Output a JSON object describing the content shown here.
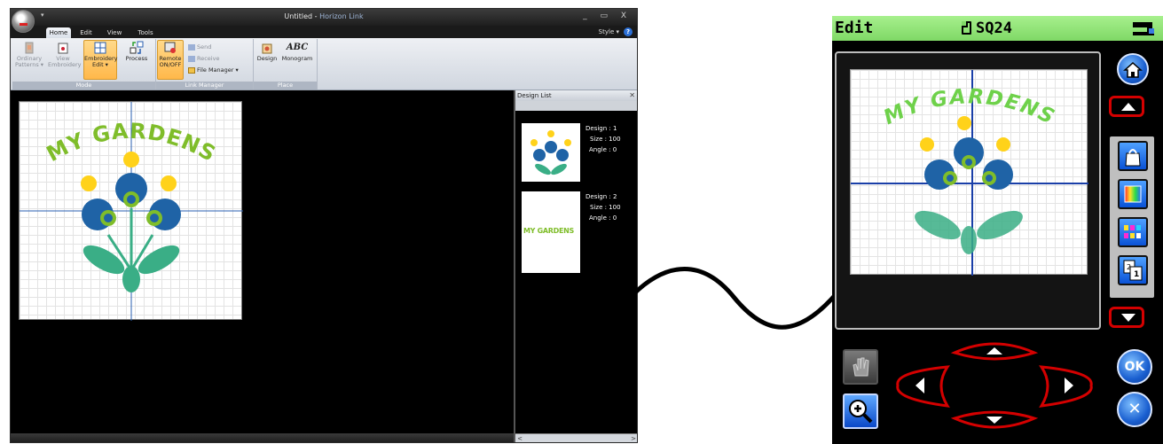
{
  "window": {
    "title_app": "Untitled",
    "title_separator": " - ",
    "title_suffix": "Horizon Link",
    "controls": "_ ▭ X",
    "qat_arrow": "▾"
  },
  "tabs": [
    "Home",
    "Edit",
    "View",
    "Tools"
  ],
  "style_menu": "Style ▾",
  "help_glyph": "?",
  "ribbon": {
    "mode": {
      "label": "Mode",
      "ordinary_patterns": "Ordinary Patterns ▾",
      "view_embroidery": "View Embroidery",
      "embroidery_edit": "Embroidery Edit ▾",
      "process": "Process"
    },
    "link_manager": {
      "label": "Link Manager",
      "remote": "Remote ON/OFF",
      "send": "Send",
      "receive": "Receive",
      "file_manager": "File Manager ▾"
    },
    "place": {
      "label": "Place",
      "design": "Design",
      "monogram": "Monogram",
      "monogram_icon_text": "ABC"
    }
  },
  "canvas": {
    "design_text": "MY GARDENS"
  },
  "design_list": {
    "title": "Design List",
    "close": "✕",
    "items": [
      {
        "design": "Design : 1",
        "size": "Size : 100",
        "angle": "Angle : 0"
      },
      {
        "design": "Design : 2",
        "size": "Size : 100",
        "angle": "Angle : 0",
        "thumb_text": "MY GARDENS"
      }
    ],
    "scroll_left": "<",
    "scroll_right": ">"
  },
  "machine": {
    "header_title": "Edit",
    "frame_label": "SQ24",
    "design_text": "MY GARDENS",
    "ok_label": "OK",
    "cancel_label": "✕"
  },
  "colors": {
    "dark_blue": "#1f63a6",
    "light_green": "#7fbd2a",
    "leaf_green": "#3aae86",
    "yellow": "#ffd21a",
    "machine_header": "#7fd866",
    "arrow_red": "#d40000"
  }
}
